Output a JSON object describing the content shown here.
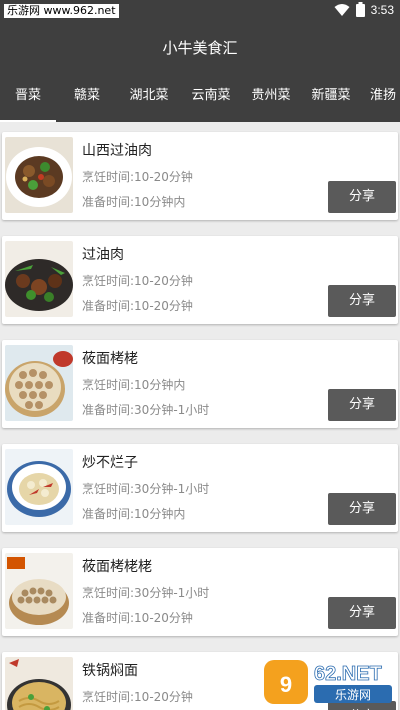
{
  "status_bar": {
    "watermark": "乐游网 www.962.net",
    "time": "3:53"
  },
  "app": {
    "title": "小牛美食汇"
  },
  "tabs": [
    {
      "label": "晋菜",
      "active": true
    },
    {
      "label": "赣菜",
      "active": false
    },
    {
      "label": "湖北菜",
      "active": false
    },
    {
      "label": "云南菜",
      "active": false
    },
    {
      "label": "贵州菜",
      "active": false
    },
    {
      "label": "新疆菜",
      "active": false
    },
    {
      "label": "淮扬",
      "active": false
    }
  ],
  "recipes": [
    {
      "title": "山西过油肉",
      "cook_time": "烹饪时间:10-20分钟",
      "prep_time": "准备时间:10分钟内",
      "share_label": "分享",
      "image": "dish-stirfry-icon"
    },
    {
      "title": "过油肉",
      "cook_time": "烹饪时间:10-20分钟",
      "prep_time": "准备时间:10-20分钟",
      "share_label": "分享",
      "image": "dish-meat-icon"
    },
    {
      "title": "莜面栲栳",
      "cook_time": "烹饪时间:10分钟内",
      "prep_time": "准备时间:30分钟-1小时",
      "share_label": "分享",
      "image": "dish-steamer-icon"
    },
    {
      "title": "炒不烂子",
      "cook_time": "烹饪时间:30分钟-1小时",
      "prep_time": "准备时间:10分钟内",
      "share_label": "分享",
      "image": "dish-bowl-icon"
    },
    {
      "title": "莜面栲栳栳",
      "cook_time": "烹饪时间:30分钟-1小时",
      "prep_time": "准备时间:10-20分钟",
      "share_label": "分享",
      "image": "dish-steamer-icon"
    },
    {
      "title": "铁锅焖面",
      "cook_time": "烹饪时间:10-20分钟",
      "prep_time": "",
      "share_label": "分享",
      "image": "dish-noodle-icon"
    }
  ],
  "watermark_bottom": {
    "brand": "962.NET",
    "sub": "乐游网"
  },
  "colors": {
    "bar": "#3f3f3f",
    "button": "#5a5a5a",
    "background": "#ececec",
    "watermark_orange": "#f39c12"
  }
}
